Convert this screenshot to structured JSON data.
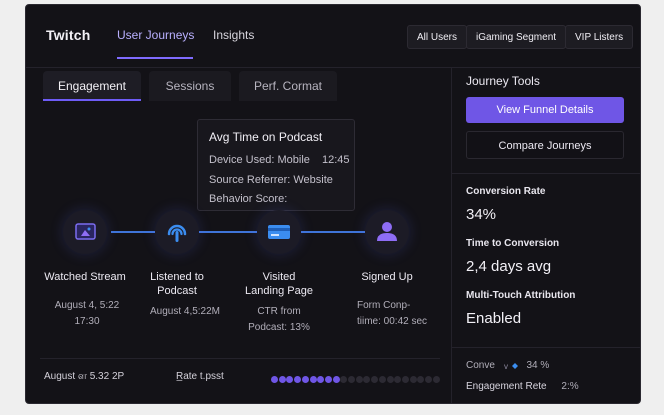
{
  "header": {
    "logo": "Twitch",
    "nav_tabs": [
      {
        "label": "User Journeys",
        "active": true
      },
      {
        "label": "Insights",
        "active": false
      }
    ],
    "segments": [
      "All Users",
      "iGaming Segment",
      "VIP Listers"
    ]
  },
  "subtabs": [
    {
      "label": "Engagement",
      "active": true
    },
    {
      "label": "Sessions",
      "active": false
    },
    {
      "label": "Perf. Cormat",
      "active": false
    }
  ],
  "tooltip": {
    "title": "Avg Time on Podcast",
    "device": "Device Used: Mobile",
    "time": "12:45",
    "referrer": "Source Referrer: Website",
    "behavior": "Behavior Score:"
  },
  "journey_steps": [
    {
      "icon": "stream-screen-icon",
      "title": "Watched Stream",
      "meta": [
        "August 4, 5:22",
        "17:30"
      ]
    },
    {
      "icon": "podcast-icon",
      "title": "Listened to Podcast",
      "meta": [
        "August 4,5:22M"
      ]
    },
    {
      "icon": "landing-page-card-icon",
      "title": "Visited Landing Page",
      "meta": [
        "CTR from",
        "Podcast: 13%"
      ]
    },
    {
      "icon": "user-icon",
      "title": "Signed Up",
      "meta": [
        "Form Conp-",
        "tiime: 00:42 sec"
      ]
    }
  ],
  "bottom": {
    "date": "August ள 5.32 2P",
    "rate": "R̲ate t.psst",
    "progress": {
      "filled": 9,
      "total": 22
    }
  },
  "journey_tools": {
    "title": "Journey Tools",
    "primary_button": "View Funnel Details",
    "secondary_button": "Compare Journeys"
  },
  "metrics": [
    {
      "label": "Conversion Rate",
      "value": "34%"
    },
    {
      "label": "Time to Conversion",
      "value": "2,4 days avg"
    },
    {
      "label": "Multi-Touch Attribution",
      "value": "Enabled"
    }
  ],
  "summary": [
    {
      "label": "Conve",
      "icon": "mini-eye-icon",
      "value": "34 %"
    },
    {
      "label": "Engagement Rete",
      "value": "2:%"
    }
  ],
  "colors": {
    "accent": "#6f56e6",
    "connector": "#3f74d8",
    "icon_blue": "#3b8df0",
    "icon_purple": "#8e6df5"
  }
}
